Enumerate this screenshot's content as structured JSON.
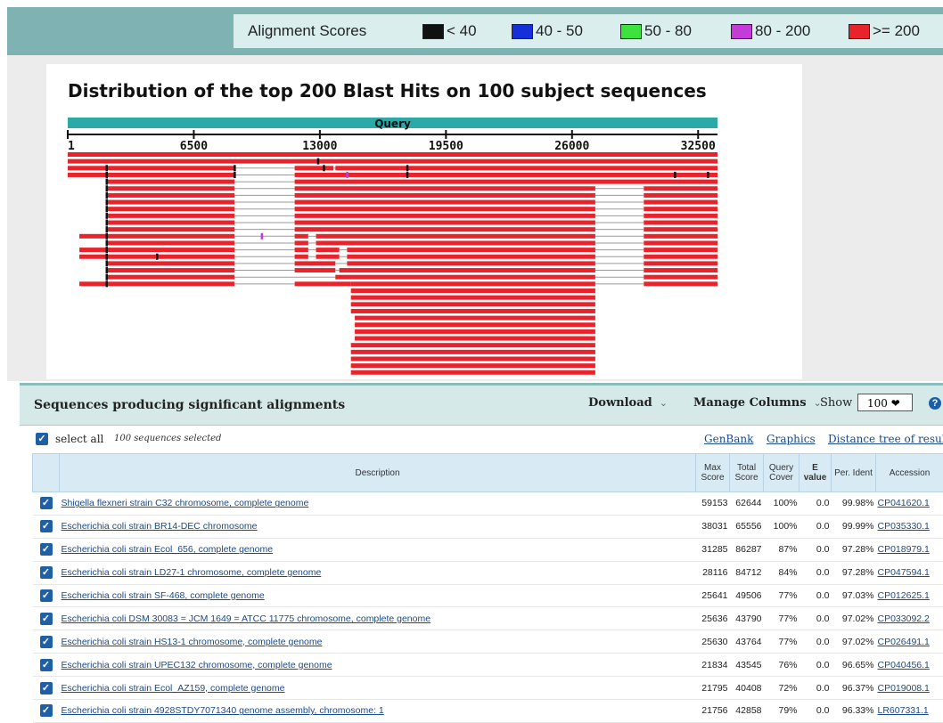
{
  "legend": {
    "title": "Alignment Scores",
    "items": [
      {
        "label": "< 40",
        "color": "#111111"
      },
      {
        "label": "40 - 50",
        "color": "#1530d8"
      },
      {
        "label": "50 - 80",
        "color": "#3ee23e"
      },
      {
        "label": "80 - 200",
        "color": "#c63ad8"
      },
      {
        "label": ">= 200",
        "color": "#e8232b"
      }
    ]
  },
  "chart_data": {
    "type": "alignment-graphic",
    "title": "Distribution of the top 200 Blast Hits on 100 subject sequences",
    "query_label": "Query",
    "query_range": [
      1,
      33500
    ],
    "ticks": [
      "1",
      "6500",
      "13000",
      "19500",
      "26000",
      "32500"
    ],
    "tick_values": [
      1,
      6500,
      13000,
      19500,
      26000,
      32500
    ],
    "colors": {
      "hit": "#e8232b",
      "connector": "#9a9a9a",
      "query": "#2aa9a6",
      "mark_dark": "#111111",
      "mark_magenta": "#c63ad8"
    },
    "rows": [
      {
        "segs": [
          [
            1,
            33500
          ]
        ],
        "marks": []
      },
      {
        "segs": [
          [
            1,
            33500
          ]
        ],
        "marks": [
          [
            12900,
            "d"
          ]
        ]
      },
      {
        "segs": [
          [
            1,
            8600
          ],
          [
            11700,
            13700
          ],
          [
            13800,
            33500
          ]
        ],
        "marks": [
          [
            2000,
            "d"
          ],
          [
            8600,
            "d"
          ],
          [
            13200,
            "d"
          ],
          [
            17500,
            "d"
          ]
        ]
      },
      {
        "segs": [
          [
            1,
            8600
          ],
          [
            11700,
            33500
          ]
        ],
        "marks": [
          [
            2000,
            "d"
          ],
          [
            8600,
            "d"
          ],
          [
            14400,
            "m"
          ],
          [
            17500,
            "d"
          ],
          [
            31300,
            "d"
          ],
          [
            33000,
            "d"
          ]
        ]
      },
      {
        "segs": [
          [
            2000,
            8600
          ],
          [
            11700,
            33500
          ]
        ],
        "marks": [
          [
            2000,
            "d"
          ]
        ]
      },
      {
        "segs": [
          [
            2000,
            8600
          ],
          [
            11700,
            27200
          ],
          [
            29700,
            33500
          ]
        ],
        "marks": [
          [
            2000,
            "d"
          ]
        ]
      },
      {
        "segs": [
          [
            2000,
            8600
          ],
          [
            11700,
            27200
          ],
          [
            29700,
            33500
          ]
        ],
        "marks": [
          [
            2000,
            "d"
          ]
        ]
      },
      {
        "segs": [
          [
            2000,
            8600
          ],
          [
            11700,
            27200
          ],
          [
            29700,
            33500
          ]
        ],
        "marks": [
          [
            2000,
            "d"
          ]
        ]
      },
      {
        "segs": [
          [
            2000,
            8600
          ],
          [
            11700,
            27200
          ],
          [
            29700,
            33500
          ]
        ],
        "marks": [
          [
            2000,
            "d"
          ]
        ]
      },
      {
        "segs": [
          [
            2000,
            8600
          ],
          [
            11700,
            27200
          ],
          [
            29700,
            33500
          ]
        ],
        "marks": [
          [
            2000,
            "d"
          ]
        ]
      },
      {
        "segs": [
          [
            2000,
            8600
          ],
          [
            11700,
            27200
          ],
          [
            29700,
            33500
          ]
        ],
        "marks": [
          [
            2000,
            "d"
          ]
        ]
      },
      {
        "segs": [
          [
            2000,
            8600
          ],
          [
            11700,
            27200
          ],
          [
            29700,
            33500
          ]
        ],
        "marks": [
          [
            2000,
            "d"
          ]
        ]
      },
      {
        "segs": [
          [
            600,
            8600
          ],
          [
            11700,
            12400
          ],
          [
            12800,
            27200
          ],
          [
            29700,
            33500
          ]
        ],
        "marks": [
          [
            2000,
            "d"
          ],
          [
            10000,
            "m"
          ]
        ]
      },
      {
        "segs": [
          [
            2000,
            8600
          ],
          [
            11700,
            12400
          ],
          [
            12800,
            27200
          ],
          [
            29700,
            33500
          ]
        ],
        "marks": [
          [
            2000,
            "d"
          ]
        ]
      },
      {
        "segs": [
          [
            600,
            8600
          ],
          [
            11700,
            12400
          ],
          [
            12800,
            14000
          ],
          [
            14400,
            27200
          ],
          [
            29700,
            33500
          ]
        ],
        "marks": [
          [
            2000,
            "d"
          ]
        ]
      },
      {
        "segs": [
          [
            600,
            8600
          ],
          [
            11700,
            12400
          ],
          [
            12800,
            14000
          ],
          [
            14400,
            27200
          ],
          [
            29700,
            33500
          ]
        ],
        "marks": [
          [
            2000,
            "d"
          ],
          [
            4600,
            "d"
          ]
        ]
      },
      {
        "segs": [
          [
            2000,
            8600
          ],
          [
            11700,
            13800
          ],
          [
            14400,
            27200
          ],
          [
            29700,
            33500
          ]
        ],
        "marks": [
          [
            2000,
            "d"
          ]
        ]
      },
      {
        "segs": [
          [
            2000,
            8600
          ],
          [
            11700,
            13800
          ],
          [
            14000,
            27200
          ],
          [
            29700,
            33500
          ]
        ],
        "marks": [
          [
            2000,
            "d"
          ]
        ]
      },
      {
        "segs": [
          [
            2000,
            8600
          ],
          [
            13800,
            27200
          ],
          [
            29700,
            33500
          ]
        ],
        "marks": [
          [
            2000,
            "d"
          ]
        ]
      },
      {
        "segs": [
          [
            600,
            8600
          ],
          [
            11700,
            14600
          ],
          [
            14600,
            27200
          ],
          [
            29700,
            33500
          ]
        ],
        "marks": [
          [
            2000,
            "d"
          ]
        ]
      },
      {
        "segs": [
          [
            14600,
            27200
          ]
        ],
        "marks": []
      },
      {
        "segs": [
          [
            14600,
            27200
          ]
        ],
        "marks": []
      },
      {
        "segs": [
          [
            14600,
            27200
          ]
        ],
        "marks": []
      },
      {
        "segs": [
          [
            14600,
            27200
          ]
        ],
        "marks": []
      },
      {
        "segs": [
          [
            14800,
            27200
          ]
        ],
        "marks": []
      },
      {
        "segs": [
          [
            14800,
            27200
          ]
        ],
        "marks": []
      },
      {
        "segs": [
          [
            14800,
            27200
          ]
        ],
        "marks": []
      },
      {
        "segs": [
          [
            14800,
            27200
          ]
        ],
        "marks": []
      },
      {
        "segs": [
          [
            14600,
            27200
          ]
        ],
        "marks": []
      },
      {
        "segs": [
          [
            14600,
            27200
          ]
        ],
        "marks": []
      },
      {
        "segs": [
          [
            14600,
            27200
          ]
        ],
        "marks": []
      },
      {
        "segs": [
          [
            14600,
            27200
          ]
        ],
        "marks": []
      },
      {
        "segs": [
          [
            14600,
            27200
          ]
        ],
        "marks": []
      }
    ]
  },
  "results": {
    "title": "Sequences producing significant alignments",
    "download": "Download",
    "manage_columns": "Manage Columns",
    "show_label": "Show",
    "show_value": "100 ❤",
    "help": "?",
    "select_all": "select all",
    "selected_count": "100 sequences selected",
    "links": [
      "GenBank",
      "Graphics",
      "Distance tree of results"
    ],
    "columns": {
      "description": "Description",
      "max_score": "Max Score",
      "total_score": "Total Score",
      "query_cover": "Query Cover",
      "e": "E",
      "e_value": "value",
      "per_ident": "Per. Ident",
      "accession": "Accession"
    },
    "rows": [
      {
        "desc": "Shigella flexneri strain C32 chromosome, complete genome",
        "max": "59153",
        "total": "62644",
        "cover": "100%",
        "evalue": "0.0",
        "ident": "99.98%",
        "acc": "CP041620.1"
      },
      {
        "desc": "Escherichia coli strain BR14-DEC chromosome",
        "max": "38031",
        "total": "65556",
        "cover": "100%",
        "evalue": "0.0",
        "ident": "99.99%",
        "acc": "CP035330.1"
      },
      {
        "desc": "Escherichia coli strain Ecol_656, complete genome",
        "max": "31285",
        "total": "86287",
        "cover": "87%",
        "evalue": "0.0",
        "ident": "97.28%",
        "acc": "CP018979.1"
      },
      {
        "desc": "Escherichia coli strain LD27-1 chromosome, complete genome",
        "max": "28116",
        "total": "84712",
        "cover": "84%",
        "evalue": "0.0",
        "ident": "97.28%",
        "acc": "CP047594.1"
      },
      {
        "desc": "Escherichia coli strain SF-468, complete genome",
        "max": "25641",
        "total": "49506",
        "cover": "77%",
        "evalue": "0.0",
        "ident": "97.03%",
        "acc": "CP012625.1"
      },
      {
        "desc": "Escherichia coli DSM 30083 = JCM 1649 = ATCC 11775 chromosome, complete genome",
        "max": "25636",
        "total": "43790",
        "cover": "77%",
        "evalue": "0.0",
        "ident": "97.02%",
        "acc": "CP033092.2"
      },
      {
        "desc": "Escherichia coli strain HS13-1 chromosome, complete genome",
        "max": "25630",
        "total": "43764",
        "cover": "77%",
        "evalue": "0.0",
        "ident": "97.02%",
        "acc": "CP026491.1"
      },
      {
        "desc": "Escherichia coli strain UPEC132 chromosome, complete genome",
        "max": "21834",
        "total": "43545",
        "cover": "76%",
        "evalue": "0.0",
        "ident": "96.65%",
        "acc": "CP040456.1"
      },
      {
        "desc": "Escherichia coli strain Ecol_AZ159, complete genome",
        "max": "21795",
        "total": "40408",
        "cover": "72%",
        "evalue": "0.0",
        "ident": "96.37%",
        "acc": "CP019008.1"
      },
      {
        "desc": "Escherichia coli strain 4928STDY7071340 genome assembly, chromosome: 1",
        "max": "21756",
        "total": "42858",
        "cover": "79%",
        "evalue": "0.0",
        "ident": "96.33%",
        "acc": "LR607331.1"
      }
    ]
  }
}
